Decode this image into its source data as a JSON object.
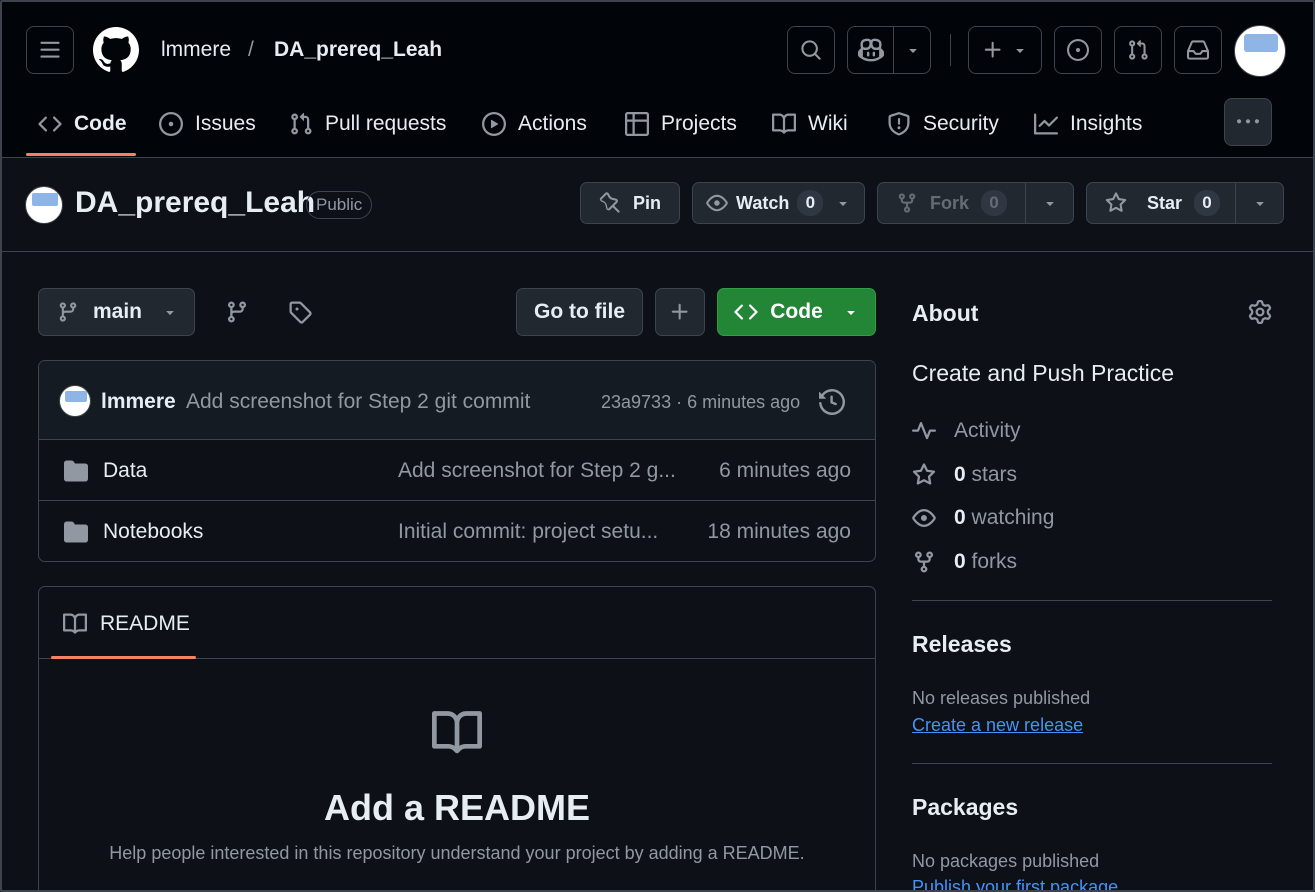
{
  "header": {
    "owner": "lmmere",
    "separator": "/",
    "repo": "DA_prereq_Leah"
  },
  "tabs": [
    {
      "label": "Code",
      "icon": "code-icon"
    },
    {
      "label": "Issues",
      "icon": "issue-icon"
    },
    {
      "label": "Pull requests",
      "icon": "pull-request-icon"
    },
    {
      "label": "Actions",
      "icon": "play-icon"
    },
    {
      "label": "Projects",
      "icon": "table-icon"
    },
    {
      "label": "Wiki",
      "icon": "book-icon"
    },
    {
      "label": "Security",
      "icon": "shield-icon"
    },
    {
      "label": "Insights",
      "icon": "graph-icon"
    }
  ],
  "repo_header": {
    "name": "DA_prereq_Leah",
    "visibility": "Public",
    "pin_label": "Pin",
    "watch_label": "Watch",
    "watch_count": "0",
    "fork_label": "Fork",
    "fork_count": "0",
    "star_label": "Star",
    "star_count": "0"
  },
  "toolbar": {
    "branch": "main",
    "go_to_file": "Go to file",
    "code_label": "Code"
  },
  "latest_commit": {
    "author": "lmmere",
    "message": "Add screenshot for Step 2 git commit",
    "meta": "23a9733 · 6 minutes ago"
  },
  "files": [
    {
      "name": "Data",
      "message": "Add screenshot for Step 2 g...",
      "time": "6 minutes ago"
    },
    {
      "name": "Notebooks",
      "message": "Initial commit: project setu...",
      "time": "18 minutes ago"
    }
  ],
  "readme": {
    "tab_label": "README",
    "title": "Add a README",
    "description": "Help people interested in this repository understand your project by adding a README."
  },
  "about": {
    "heading": "About",
    "description": "Create and Push Practice",
    "activity": "Activity",
    "stars_count": "0",
    "stars_label": "stars",
    "watching_count": "0",
    "watching_label": "watching",
    "forks_count": "0",
    "forks_label": "forks"
  },
  "releases": {
    "heading": "Releases",
    "empty": "No releases published",
    "link": "Create a new release"
  },
  "packages": {
    "heading": "Packages",
    "empty": "No packages published",
    "link": "Publish your first package"
  },
  "colors": {
    "background": "#0d1117",
    "header": "#010409",
    "accent_underline": "#f78166",
    "green_button": "#238636",
    "link": "#4493f8"
  }
}
